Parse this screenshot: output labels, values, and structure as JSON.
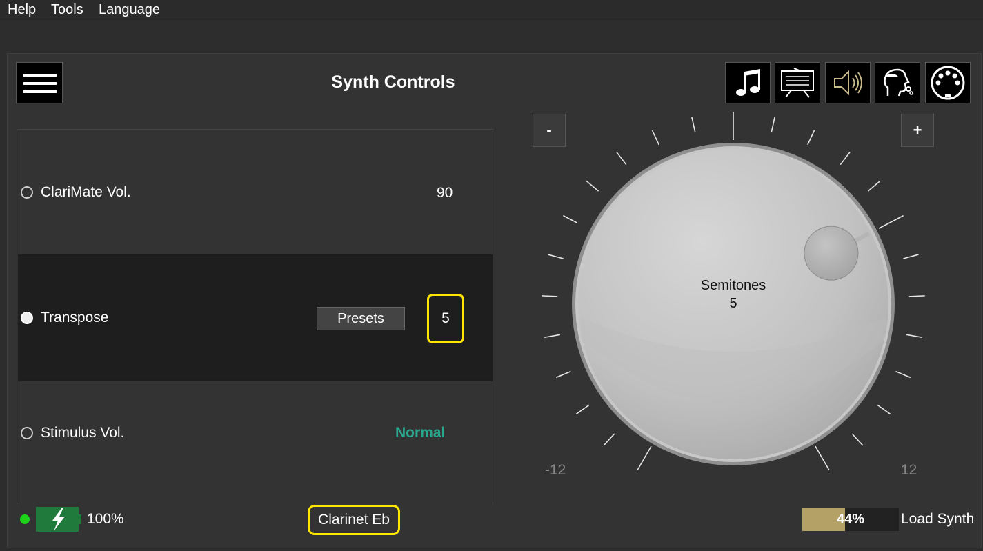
{
  "menu": [
    "Help",
    "Tools",
    "Language"
  ],
  "title": "Synth Controls",
  "toolbar": [
    {
      "icon": "music-note-icon"
    },
    {
      "icon": "sheet-music-stand-icon"
    },
    {
      "icon": "speaker-icon"
    },
    {
      "icon": "breath-face-icon"
    },
    {
      "icon": "midi-connector-icon"
    }
  ],
  "rows": [
    {
      "label": "ClariMate Vol.",
      "value": "90",
      "selected": false
    },
    {
      "label": "Transpose",
      "value": "5",
      "button": "Presets",
      "selected": true
    },
    {
      "label": "Stimulus Vol.",
      "value": "Normal",
      "selected": false
    }
  ],
  "dial": {
    "minus": "-",
    "plus": "+",
    "label": "Semitones",
    "value": "5",
    "min": "-12",
    "max": "12",
    "current": 5,
    "range": [
      -12,
      12
    ]
  },
  "status": {
    "battery_pct": "100%",
    "instrument": "Clarinet Eb",
    "load_pct": "44%",
    "load_fraction": 0.44,
    "load_label": "Load Synth"
  },
  "colors": {
    "highlight": "#ffe600",
    "accent_teal": "#2aa88e",
    "status_green": "#1dd31d",
    "battery_green": "#1f7a3c",
    "progress_fill": "#b4a166"
  }
}
